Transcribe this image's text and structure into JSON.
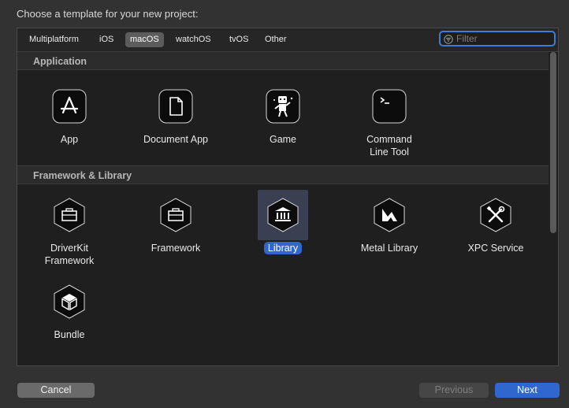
{
  "dialog": {
    "title": "Choose a template for your new project:"
  },
  "tabs": [
    {
      "label": "Multiplatform"
    },
    {
      "label": "iOS"
    },
    {
      "label": "macOS",
      "active": true
    },
    {
      "label": "watchOS"
    },
    {
      "label": "tvOS"
    },
    {
      "label": "Other"
    }
  ],
  "filter": {
    "placeholder": "Filter",
    "value": ""
  },
  "sections": {
    "application": {
      "title": "Application",
      "items": [
        {
          "label": "App",
          "icon": "app-store-icon"
        },
        {
          "label": "Document App",
          "icon": "document-icon"
        },
        {
          "label": "Game",
          "icon": "game-robot-icon"
        },
        {
          "label": "Command Line Tool",
          "icon": "terminal-icon"
        }
      ]
    },
    "framework": {
      "title": "Framework & Library",
      "items": [
        {
          "label": "DriverKit Framework",
          "icon": "toolbox-icon"
        },
        {
          "label": "Framework",
          "icon": "toolbox-icon"
        },
        {
          "label": "Library",
          "icon": "library-building-icon",
          "selected": true
        },
        {
          "label": "Metal Library",
          "icon": "metal-icon"
        },
        {
          "label": "XPC Service",
          "icon": "wrench-screwdriver-icon"
        },
        {
          "label": "Bundle",
          "icon": "cube-icon"
        }
      ]
    }
  },
  "buttons": {
    "cancel": "Cancel",
    "previous": "Previous",
    "next": "Next"
  },
  "colors": {
    "accent": "#2f67cf",
    "focus_ring": "#3b7ed8",
    "selection_bg": "#3a3f51"
  }
}
